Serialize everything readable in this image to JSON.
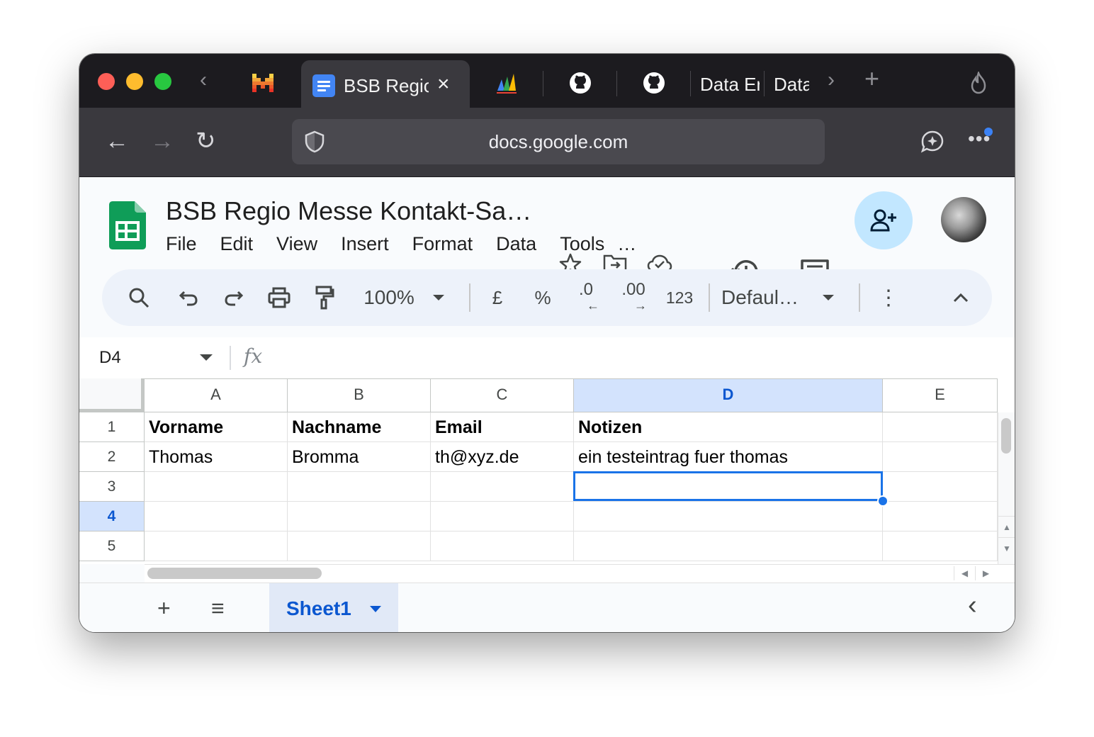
{
  "browser": {
    "active_tab": {
      "title": "BSB Regio Messe Kontakt-Sammlung",
      "close": "×"
    },
    "tabs_text": [
      "Data Er",
      "Data"
    ],
    "url": "docs.google.com"
  },
  "doc": {
    "title": "BSB Regio Messe Kontakt-Sa…",
    "menu": [
      "File",
      "Edit",
      "View",
      "Insert",
      "Format",
      "Data",
      "Tools",
      "…"
    ]
  },
  "toolbar": {
    "zoom": "100%",
    "currency": "£",
    "percent": "%",
    "dec_decrease": ".0",
    "dec_increase": ".00",
    "number_format": "123",
    "font": "Defaul…"
  },
  "formula_bar": {
    "name_box": "D4",
    "fx": "fx",
    "value": ""
  },
  "grid": {
    "columns": [
      "A",
      "B",
      "C",
      "D",
      "E"
    ],
    "selected_column": "D",
    "rows": [
      "1",
      "2",
      "3",
      "4",
      "5"
    ],
    "selected_row": "4",
    "cells": [
      [
        "Vorname",
        "Nachname",
        "Email",
        "Notizen",
        ""
      ],
      [
        "Thomas",
        "Bromma",
        "th@xyz.de",
        "ein testeintrag fuer thomas",
        ""
      ],
      [
        "",
        "",
        "",
        "",
        ""
      ],
      [
        "",
        "",
        "",
        "",
        ""
      ],
      [
        "",
        "",
        "",
        "",
        ""
      ]
    ]
  },
  "sheets": {
    "add": "+",
    "list": "≡",
    "active": "Sheet1",
    "collapse": "‹"
  },
  "colors": {
    "accent": "#1a73e8",
    "sheets_green": "#0f9d58",
    "share_bg": "#c2e7ff"
  }
}
